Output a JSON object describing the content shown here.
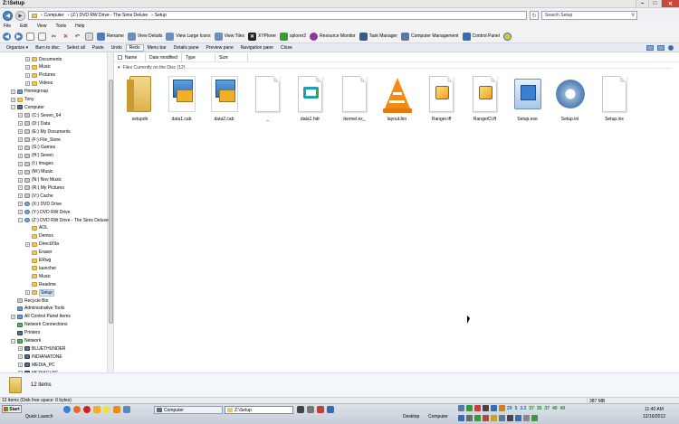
{
  "window": {
    "title": "Z:\\Setup"
  },
  "address": {
    "segments": [
      "Computer",
      "(Z:) DVD RW Drive - The Sims Deluxe",
      "Setup"
    ],
    "search_placeholder": "Search Setup"
  },
  "menu": [
    "File",
    "Edit",
    "View",
    "Tools",
    "Help"
  ],
  "toolbar1": [
    {
      "label": "Rename",
      "icon": "rename-icon",
      "color": "#4a7fc1"
    },
    {
      "label": "View Details",
      "icon": "details-icon",
      "color": "#6a8fbf"
    },
    {
      "label": "View Large Icons",
      "icon": "large-icons-icon",
      "color": "#6a8fbf"
    },
    {
      "label": "View Tiles",
      "icon": "tiles-icon",
      "color": "#6a8fbf"
    },
    {
      "label": "XYPlorer",
      "icon": "xyplorer-icon",
      "color": "#222222"
    },
    {
      "label": "xplorer2",
      "icon": "xplorer2-icon",
      "color": "#3a9a3a"
    },
    {
      "label": "Resource Monitor",
      "icon": "resource-monitor-icon",
      "color": "#8a3a9a"
    },
    {
      "label": "Task Manager",
      "icon": "task-manager-icon",
      "color": "#3a5a8a"
    },
    {
      "label": "Computer Management",
      "icon": "computer-management-icon",
      "color": "#5a7aa0"
    },
    {
      "label": "Control Panel",
      "icon": "control-panel-icon",
      "color": "#3a6ab0"
    }
  ],
  "toolbar2": {
    "items": [
      "Organize ▾",
      "Burn to disc",
      "Select all",
      "Paste",
      "Undo",
      "Redo",
      "Menu bar",
      "Details pane",
      "Preview pane",
      "Navigation pane",
      "Close"
    ],
    "pressed_index": 5
  },
  "columns": [
    "Name",
    "Date modified",
    "Type",
    "Size"
  ],
  "group_header": "Files Currently on the Disc (12)",
  "files": [
    {
      "name": "setupdir",
      "kind": "folder"
    },
    {
      "name": "data1.cab",
      "kind": "cab"
    },
    {
      "name": "data2.cab",
      "kind": "cab"
    },
    {
      "name": "_",
      "kind": "blank"
    },
    {
      "name": "data1.hdr",
      "kind": "hdr"
    },
    {
      "name": "ikernel.ex_",
      "kind": "blank"
    },
    {
      "name": "layout.bin",
      "kind": "vlc"
    },
    {
      "name": "Ranger.iff",
      "kind": "iff"
    },
    {
      "name": "RangerD.iff",
      "kind": "iff"
    },
    {
      "name": "Setup.exe",
      "kind": "exe"
    },
    {
      "name": "Setup.ini",
      "kind": "ini"
    },
    {
      "name": "Setup.inx",
      "kind": "blank"
    }
  ],
  "nav_tree": [
    {
      "label": "Documents",
      "indent": 2,
      "icon": "fi-folder",
      "exp": "+"
    },
    {
      "label": "Music",
      "indent": 2,
      "icon": "fi-folder",
      "exp": "+"
    },
    {
      "label": "Pictures",
      "indent": 2,
      "icon": "fi-folder",
      "exp": "+"
    },
    {
      "label": "Videos",
      "indent": 2,
      "icon": "fi-folder",
      "exp": "+"
    },
    {
      "label": "Homegroup",
      "indent": 0,
      "icon": "fi-blue",
      "exp": "+"
    },
    {
      "label": "Tony",
      "indent": 0,
      "icon": "fi-folder",
      "exp": "+"
    },
    {
      "label": "Computer",
      "indent": 0,
      "icon": "fi-pc",
      "exp": "−"
    },
    {
      "label": "(C:) Seven_64",
      "indent": 1,
      "icon": "fi-drive",
      "exp": "+"
    },
    {
      "label": "(D:) Data",
      "indent": 1,
      "icon": "fi-drive",
      "exp": "+"
    },
    {
      "label": "(E:) My Documents",
      "indent": 1,
      "icon": "fi-drive",
      "exp": "+"
    },
    {
      "label": "(F:) File_Store",
      "indent": 1,
      "icon": "fi-drive",
      "exp": "+"
    },
    {
      "label": "(G:) Games",
      "indent": 1,
      "icon": "fi-drive",
      "exp": "+"
    },
    {
      "label": "(H:) Seven",
      "indent": 1,
      "icon": "fi-drive",
      "exp": "+"
    },
    {
      "label": "(I:) Images",
      "indent": 1,
      "icon": "fi-drive",
      "exp": "+"
    },
    {
      "label": "(M:) Music",
      "indent": 1,
      "icon": "fi-drive",
      "exp": "+"
    },
    {
      "label": "(N:) Nov Music",
      "indent": 1,
      "icon": "fi-drive",
      "exp": "+"
    },
    {
      "label": "(R:) My Pictures",
      "indent": 1,
      "icon": "fi-drive",
      "exp": "+"
    },
    {
      "label": "(V:) Cache",
      "indent": 1,
      "icon": "fi-drive",
      "exp": "+"
    },
    {
      "label": "(X:) DVD Drive",
      "indent": 1,
      "icon": "fi-disc",
      "exp": "+"
    },
    {
      "label": "(Y:) DVD RW Drive",
      "indent": 1,
      "icon": "fi-disc",
      "exp": "+"
    },
    {
      "label": "(Z:) DVD RW Drive - The Sims Deluxe",
      "indent": 1,
      "icon": "fi-disc",
      "exp": "−"
    },
    {
      "label": "AOL",
      "indent": 2,
      "icon": "fi-folder",
      "exp": ""
    },
    {
      "label": "Demos",
      "indent": 2,
      "icon": "fi-folder",
      "exp": ""
    },
    {
      "label": "DirectX9a",
      "indent": 2,
      "icon": "fi-folder",
      "exp": "+"
    },
    {
      "label": "Eraser",
      "indent": 2,
      "icon": "fi-folder",
      "exp": ""
    },
    {
      "label": "ERwg",
      "indent": 2,
      "icon": "fi-folder",
      "exp": ""
    },
    {
      "label": "launcher",
      "indent": 2,
      "icon": "fi-folder",
      "exp": ""
    },
    {
      "label": "Music",
      "indent": 2,
      "icon": "fi-folder",
      "exp": ""
    },
    {
      "label": "Readme",
      "indent": 2,
      "icon": "fi-folder",
      "exp": ""
    },
    {
      "label": "Setup",
      "indent": 2,
      "icon": "fi-folder",
      "exp": "+",
      "selected": true
    },
    {
      "label": "Recycle Bin",
      "indent": 0,
      "icon": "fi-drive",
      "exp": ""
    },
    {
      "label": "Administrative Tools",
      "indent": 0,
      "icon": "fi-blue",
      "exp": ""
    },
    {
      "label": "All Control Panel Items",
      "indent": 0,
      "icon": "fi-blue",
      "exp": "+"
    },
    {
      "label": "Network Connections",
      "indent": 0,
      "icon": "fi-net",
      "exp": ""
    },
    {
      "label": "Printers",
      "indent": 0,
      "icon": "fi-pc",
      "exp": ""
    },
    {
      "label": "Network",
      "indent": 0,
      "icon": "fi-net",
      "exp": "−"
    },
    {
      "label": "BLUETHUNDER",
      "indent": 1,
      "icon": "fi-pc",
      "exp": "+"
    },
    {
      "label": "INDIANATONE",
      "indent": 1,
      "icon": "fi-pc",
      "exp": "+"
    },
    {
      "label": "MEDIA_PC",
      "indent": 1,
      "icon": "fi-pc",
      "exp": "+"
    },
    {
      "label": "MEDIACLPC",
      "indent": 1,
      "icon": "fi-pc",
      "exp": "+"
    }
  ],
  "details_pane": {
    "count": "12 items"
  },
  "status": {
    "left": "12 items (Disk free space: 0 bytes)",
    "right": "387 MB"
  },
  "taskbar": {
    "start": "Start",
    "quick_launch": "Quick Launch",
    "tasks": [
      {
        "label": "Computer",
        "active": false
      },
      {
        "label": "Z:\\Setup",
        "active": true
      }
    ],
    "desktop_label": "Desktop",
    "computer_label": "Computer",
    "tray_numbers": [
      "29",
      "5",
      "3.3",
      "37",
      "35",
      "37",
      "40",
      "40"
    ],
    "clock": {
      "time": "11:40 AM",
      "date": "12/16/2012"
    }
  }
}
